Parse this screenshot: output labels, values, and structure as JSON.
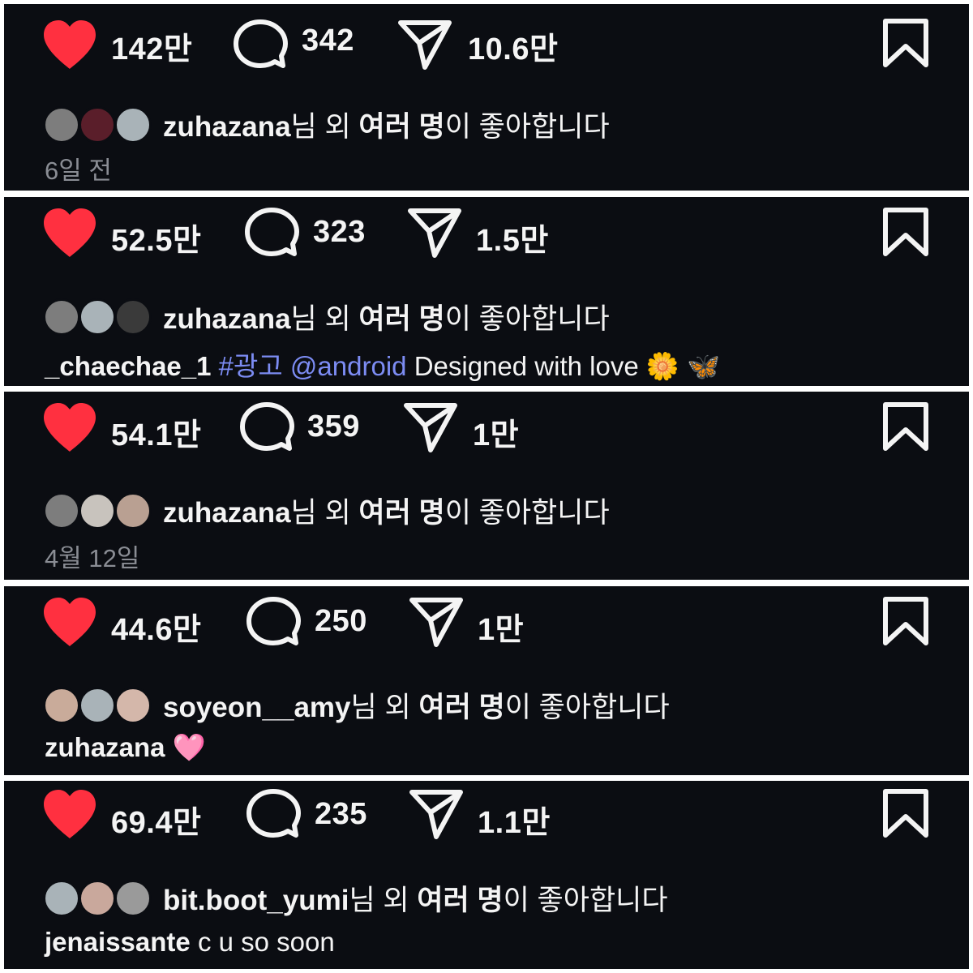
{
  "posts": [
    {
      "likes": "142만",
      "comments": "342",
      "shares": "10.6만",
      "liker": "zuhazana",
      "liked_suffix": "님 외 ",
      "liked_bold": "여러 명",
      "liked_end": "이 좋아합니다",
      "date": "6일 전",
      "avatar_colors": [
        "#7d7d7d",
        "#5a1e2a",
        "#a9b3b8"
      ]
    },
    {
      "likes": "52.5만",
      "comments": "323",
      "shares": "1.5만",
      "liker": "zuhazana",
      "liked_suffix": "님 외 ",
      "liked_bold": "여러 명",
      "liked_end": "이 좋아합니다",
      "caption_user": "_chaechae_1",
      "caption_hashtag": "#광고",
      "caption_mention": "@android",
      "caption_text": "Designed with love 🌼 🦋",
      "avatar_colors": [
        "#7d7d7d",
        "#a9b3b8",
        "#3a3a3a"
      ]
    },
    {
      "likes": "54.1만",
      "comments": "359",
      "shares": "1만",
      "liker": "zuhazana",
      "liked_suffix": "님 외 ",
      "liked_bold": "여러 명",
      "liked_end": "이 좋아합니다",
      "date": "4월 12일",
      "avatar_colors": [
        "#7d7d7d",
        "#c8c3bd",
        "#b9a092"
      ]
    },
    {
      "likes": "44.6만",
      "comments": "250",
      "shares": "1만",
      "liker": "soyeon__amy",
      "liked_suffix": "님 외 ",
      "liked_bold": "여러 명",
      "liked_end": "이 좋아합니다",
      "caption_user": "zuhazana",
      "caption_text": "🩷",
      "avatar_colors": [
        "#c9ab9a",
        "#a9b3b8",
        "#d4b7aa"
      ]
    },
    {
      "likes": "69.4만",
      "comments": "235",
      "shares": "1.1만",
      "liker": "bit.boot_yumi",
      "liked_suffix": "님 외 ",
      "liked_bold": "여러 명",
      "liked_end": "이 좋아합니다",
      "caption_user": "jenaissante",
      "caption_text": "c u so soon",
      "avatar_colors": [
        "#a9b3b8",
        "#c9a89c",
        "#9a9a9a"
      ]
    }
  ],
  "icons": {
    "like": "heart-icon",
    "comment": "comment-bubble-icon",
    "share": "paper-plane-icon",
    "save": "bookmark-icon"
  },
  "colors": {
    "background": "#0b0d12",
    "like_red": "#ff3040",
    "hashtag_blue": "#7c8cf3",
    "date_gray": "#8a8d94"
  }
}
